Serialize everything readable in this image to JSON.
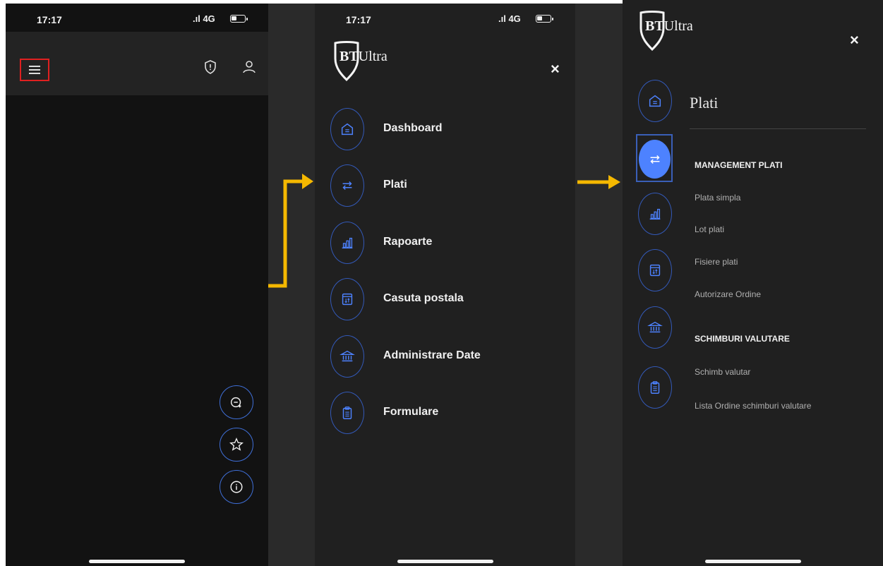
{
  "status": {
    "time": "17:17",
    "network": "4G"
  },
  "screen1": {
    "menu_button": "menu-icon",
    "header_icons": [
      "shield-alert-icon",
      "user-icon"
    ],
    "fabs": [
      "chat-add-icon",
      "star-icon",
      "info-icon"
    ]
  },
  "logo": {
    "bt": "BT",
    "ultra": "Ultra"
  },
  "close_label": "×",
  "screen2": {
    "menu": [
      {
        "label": "Dashboard",
        "icon": "home-icon"
      },
      {
        "label": "Plati",
        "icon": "transfer-icon"
      },
      {
        "label": "Rapoarte",
        "icon": "chart-icon"
      },
      {
        "label": "Casuta postala",
        "icon": "mailbox-icon"
      },
      {
        "label": "Administrare Date",
        "icon": "bank-icon"
      },
      {
        "label": "Formulare",
        "icon": "clipboard-icon"
      }
    ]
  },
  "screen3": {
    "title": "Plati",
    "sections": [
      {
        "heading": "MANAGEMENT PLATI",
        "items": [
          "Plata simpla",
          "Lot plati",
          "Fisiere plati",
          "Autorizare Ordine"
        ]
      },
      {
        "heading": "SCHIMBURI VALUTARE",
        "items": [
          "Schimb valutar",
          "Lista Ordine schimburi valutare"
        ]
      }
    ]
  },
  "colors": {
    "accent": "#4d82ff",
    "arrow": "#f5b800",
    "highlight": "#e02020",
    "ring": "#3359b8"
  }
}
